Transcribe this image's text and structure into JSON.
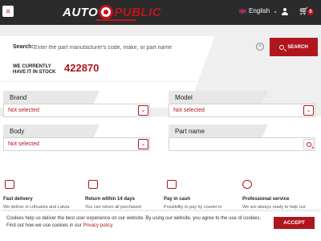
{
  "header": {
    "logo_left": "AUTO",
    "logo_right": "PUBLIC",
    "language": "English",
    "cart_count": "0",
    "colors": {
      "bar": "#2b2b2b",
      "accent": "#c0141b"
    }
  },
  "search": {
    "label": "Search:",
    "placeholder": "Enter the part manufacturer's code, make, or part name",
    "clear_icon": "×",
    "button_label": "SEARCH"
  },
  "stock": {
    "label": "WE CURRENTLY HAVE IT IN STOCK",
    "count": "422870"
  },
  "filters": {
    "brand": {
      "label": "Brand",
      "value": "Not selected"
    },
    "model": {
      "label": "Model",
      "value": "Not selected"
    },
    "body": {
      "label": "Body",
      "value": "Not selected"
    },
    "part_name": {
      "label": "Part name",
      "value": ""
    },
    "dropdown_glyph": "⌄"
  },
  "features": [
    {
      "icon": "truck-icon",
      "title": "Fast delivery",
      "text": "We deliver in Lithuania and Latvia"
    },
    {
      "icon": "calendar-icon",
      "title": "Return within 14 days",
      "text": "You can return all purchased"
    },
    {
      "icon": "cash-icon",
      "title": "Pay in cash",
      "text": "Possibility to pay by courier in"
    },
    {
      "icon": "support-icon",
      "title": "Professional service",
      "text": "We are always ready to help our"
    }
  ],
  "cookie": {
    "text": "Cookies help us deliver the best user experience on our website. By using our website, you agree to the use of cookies. Find out how we use cookies in our",
    "link": "Privacy policy.",
    "accept": "ACCEPT"
  }
}
